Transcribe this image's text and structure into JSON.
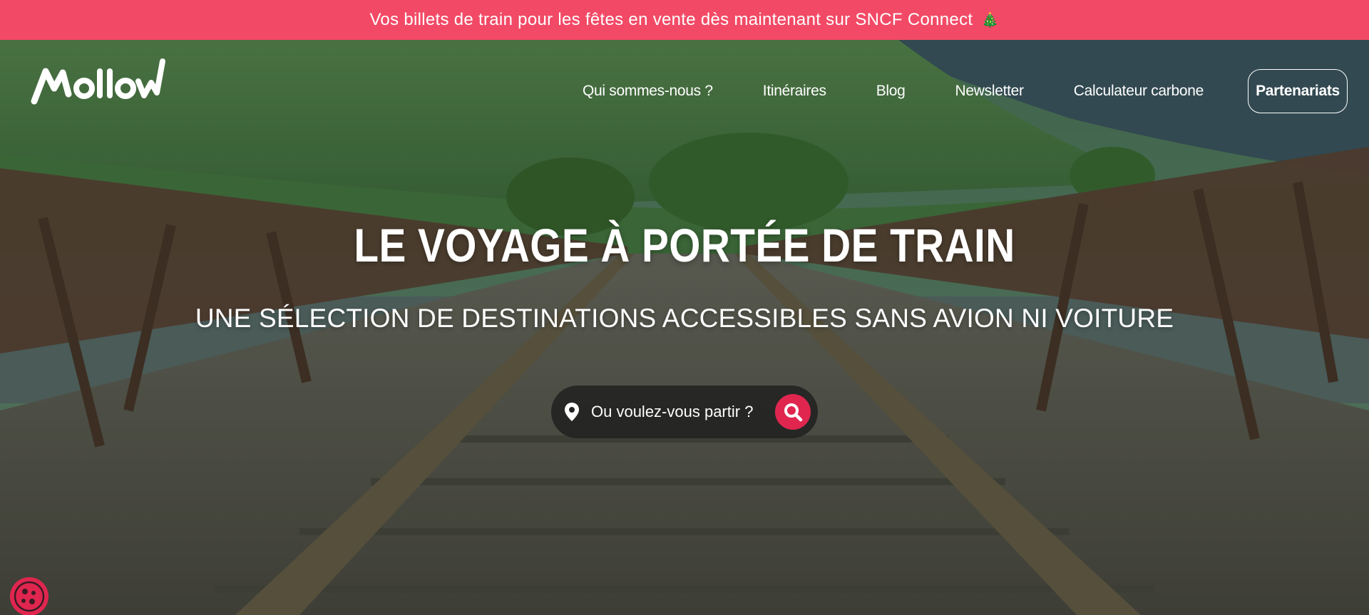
{
  "announcement": {
    "text": "Vos billets de train pour les fêtes en vente dès maintenant sur SNCF Connect",
    "emoji": "🎄"
  },
  "brand": {
    "name": "Mollow",
    "logo_icon": "mollow-logo"
  },
  "nav": {
    "items": [
      "Qui sommes-nous ?",
      "Itinéraires",
      "Blog",
      "Newsletter",
      "Calculateur carbone"
    ],
    "cta": "Partenariats"
  },
  "hero": {
    "title": "LE VOYAGE À PORTÉE DE TRAIN",
    "subtitle": "UNE SÉLECTION DE DESTINATIONS ACCESSIBLES SANS AVION NI VOITURE"
  },
  "search": {
    "placeholder": "Ou voulez-vous partir ?",
    "pin_icon": "map-pin-icon",
    "button_icon": "search-icon"
  },
  "cookie": {
    "icon": "cookie-icon"
  },
  "colors": {
    "accent": "#e0264f",
    "banner": "#f24a66",
    "text": "#ffffff"
  }
}
